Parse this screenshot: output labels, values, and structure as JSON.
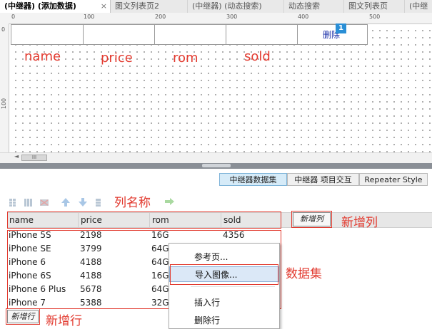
{
  "tabs": [
    {
      "label": "(中继器) (添加数据)",
      "active": true,
      "close": "×"
    },
    {
      "label": "图文列表页2",
      "active": false
    },
    {
      "label": "(中继器) (动态搜索)",
      "active": false
    },
    {
      "label": "动态搜索",
      "active": false
    },
    {
      "label": "图文列表页",
      "active": false
    },
    {
      "label": "(中继",
      "active": false
    }
  ],
  "ruler": {
    "h": [
      "0",
      "100",
      "200",
      "300",
      "400",
      "500"
    ],
    "v": [
      "0",
      "100"
    ]
  },
  "canvas": {
    "delete_label": "删除",
    "badge": "1",
    "field_labels": [
      "name",
      "price",
      "rom",
      "sold"
    ]
  },
  "scroll": {
    "left_arrow": "◄",
    "grip": "III"
  },
  "panel_tabs": [
    "中继器数据集",
    "中继器 项目交互",
    "Repeater Style"
  ],
  "toolbar_icons": [
    "grid-icon",
    "columns-icon",
    "delete-columns-icon",
    "arrow-up-icon",
    "arrow-down-icon",
    "table-icon",
    "arrow-right-icon"
  ],
  "grid": {
    "columns": [
      "name",
      "price",
      "rom",
      "sold"
    ],
    "rows": [
      [
        "iPhone 5S",
        "2198",
        "16G",
        "4356"
      ],
      [
        "iPhone SE",
        "3799",
        "64G",
        ""
      ],
      [
        "iPhone 6",
        "4188",
        "64G",
        ""
      ],
      [
        "iPhone 6S",
        "4188",
        "16G",
        ""
      ],
      [
        "iPhone 6 Plus",
        "5678",
        "64G",
        ""
      ],
      [
        "iPhone 7",
        "5388",
        "32G",
        ""
      ]
    ],
    "add_column": "新增列",
    "add_row": "新增行"
  },
  "annotations": {
    "column_name": "列名称",
    "add_column": "新增列",
    "dataset": "数据集",
    "add_row": "新增行"
  },
  "context_menu": {
    "items": [
      "参考页...",
      "导入图像...",
      "插入行",
      "删除行"
    ],
    "highlighted": 1
  },
  "colors": {
    "accent": "#2a8fd6",
    "annotation": "#e23a2f",
    "highlight": "#dbe8f7"
  }
}
